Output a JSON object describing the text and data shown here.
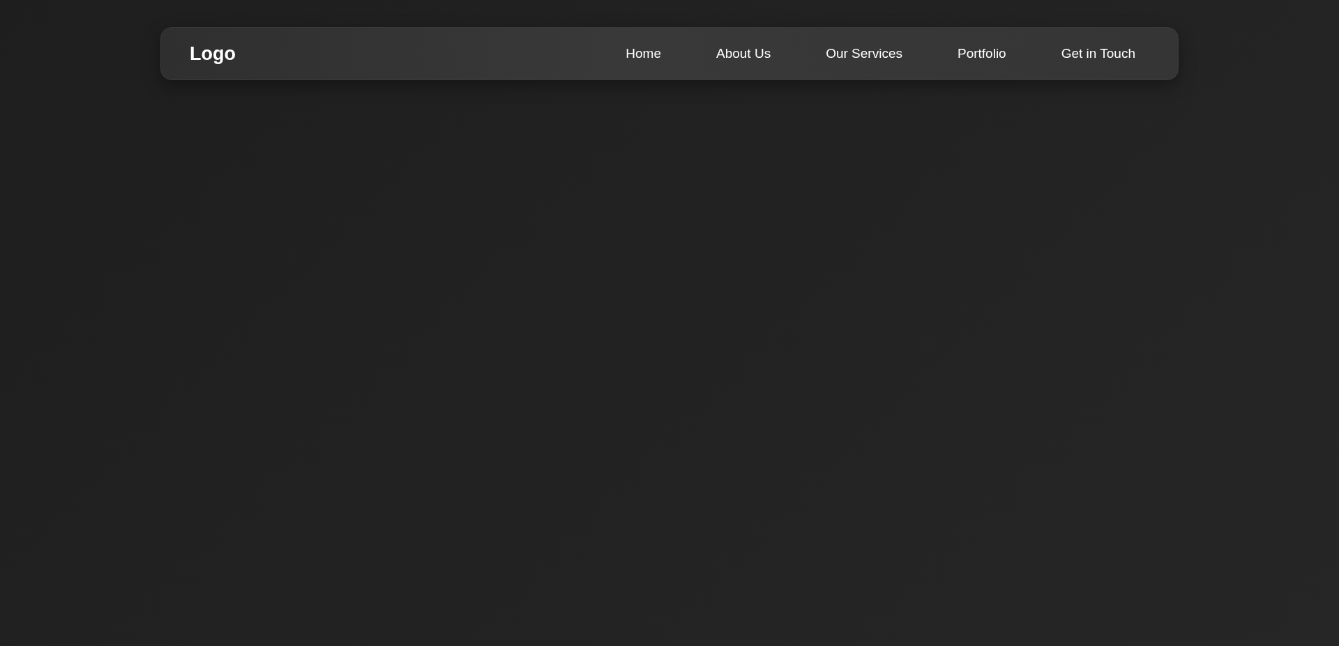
{
  "navbar": {
    "logo": "Logo",
    "links": [
      "Home",
      "About Us",
      "Our Services",
      "Portfolio",
      "Get in Touch"
    ]
  }
}
